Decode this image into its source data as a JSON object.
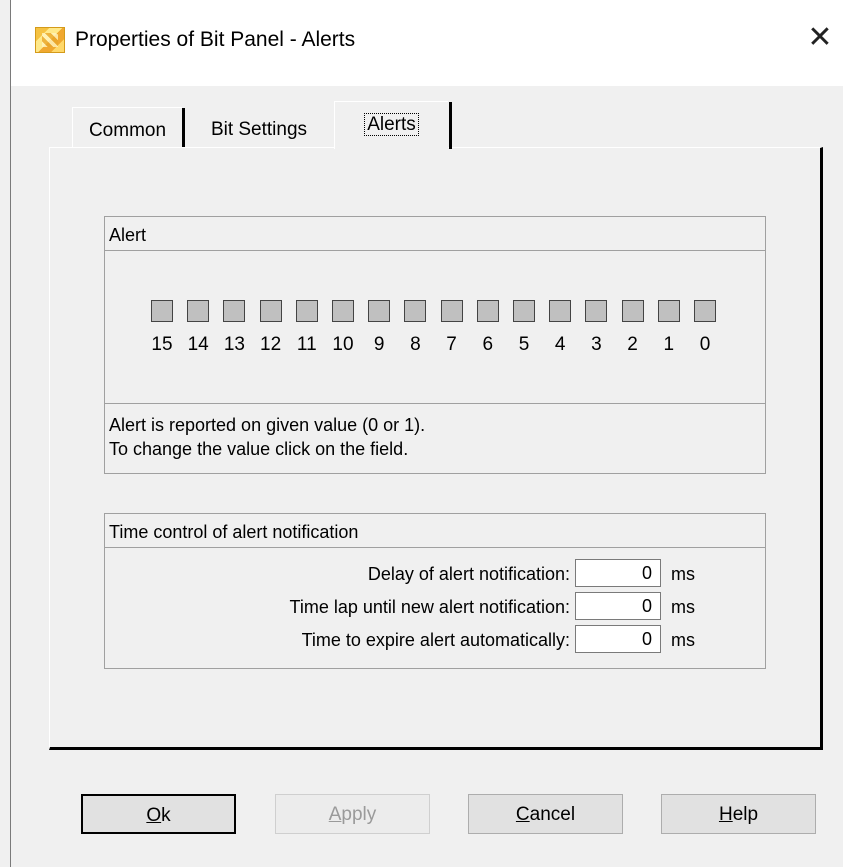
{
  "window": {
    "title": "Properties of Bit Panel - Alerts",
    "close_glyph": "✕"
  },
  "tabs": [
    {
      "label": "Common",
      "active": false
    },
    {
      "label": "Bit Settings",
      "active": false
    },
    {
      "label": "Alerts",
      "active": true
    }
  ],
  "alert_group": {
    "title": "Alert",
    "bits": [
      "15",
      "14",
      "13",
      "12",
      "11",
      "10",
      "9",
      "8",
      "7",
      "6",
      "5",
      "4",
      "3",
      "2",
      "1",
      "0"
    ],
    "info_line1": "Alert is reported on given value (0 or 1).",
    "info_line2": "To change the value click on the field."
  },
  "time_group": {
    "title": "Time control of alert notification",
    "rows": [
      {
        "label": "Delay of alert notification:",
        "value": "0",
        "unit": "ms"
      },
      {
        "label": "Time lap until new alert notification:",
        "value": "0",
        "unit": "ms"
      },
      {
        "label": "Time to expire alert automatically:",
        "value": "0",
        "unit": "ms"
      }
    ]
  },
  "buttons": {
    "ok_mnemonic": "O",
    "ok_rest": "k",
    "apply_mnemonic": "A",
    "apply_rest": "pply",
    "cancel_mnemonic": "C",
    "cancel_rest": "ancel",
    "help_mnemonic": "H",
    "help_rest": "elp"
  },
  "colors": {
    "bit_fill": "#c0c0c0",
    "dialog_bg": "#f0f0f0"
  }
}
